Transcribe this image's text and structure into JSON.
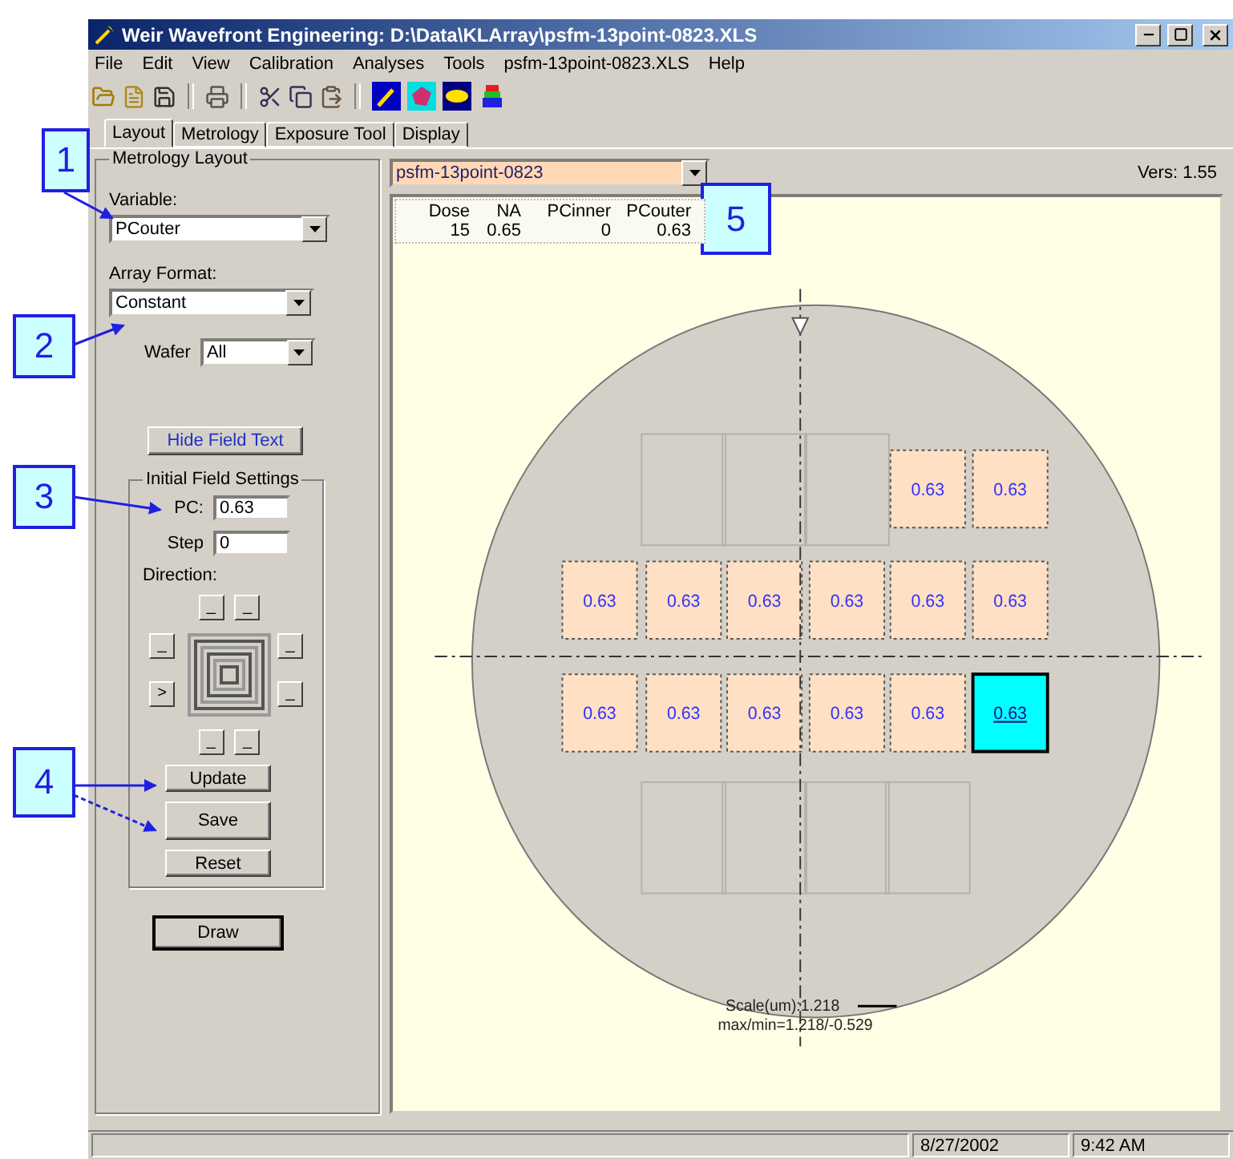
{
  "window": {
    "title": "Weir Wavefront Engineering: D:\\Data\\KLArray\\psfm-13point-0823.XLS"
  },
  "menu": [
    "File",
    "Edit",
    "View",
    "Calibration",
    "Analyses",
    "Tools",
    "psfm-13point-0823.XLS",
    "Help"
  ],
  "tabs": [
    {
      "label": "Layout",
      "selected": true
    },
    {
      "label": "Metrology",
      "selected": false
    },
    {
      "label": "Exposure Tool",
      "selected": false
    },
    {
      "label": "Display",
      "selected": false
    }
  ],
  "layout_panel": {
    "title": "Metrology Layout",
    "variable": {
      "label": "Variable:",
      "value": "PCouter"
    },
    "array_format": {
      "label": "Array Format:",
      "value": "Constant"
    },
    "wafer": {
      "label": "Wafer",
      "value": "All"
    },
    "hide_button": "Hide Field Text",
    "initial_settings": {
      "title": "Initial Field Settings",
      "pc": {
        "label": "PC:",
        "value": "0.63"
      },
      "step": {
        "label": "Step",
        "value": "0"
      },
      "direction_label": "Direction:",
      "direction_buttons": [
        "_",
        "_",
        "_",
        "_",
        ">",
        "_",
        "_",
        "_"
      ],
      "buttons": [
        "Update",
        "Save",
        "Reset"
      ]
    },
    "draw_button": {
      "label": "Draw",
      "default": true
    }
  },
  "layout_file": {
    "value": "psfm-13point-0823"
  },
  "version": "Vers: 1.55",
  "info_table": {
    "columns": [
      "Dose",
      "NA",
      "PCinner",
      "PCouter"
    ],
    "values": [
      "15",
      "0.65",
      "0",
      "0.63"
    ]
  },
  "wafer_map": {
    "rows": [
      {
        "cells": [
          {
            "kind": "none"
          },
          {
            "kind": "empty"
          },
          {
            "kind": "empty"
          },
          {
            "kind": "empty"
          },
          {
            "kind": "field",
            "value": "0.63",
            "selected": false
          },
          {
            "kind": "field",
            "value": "0.63",
            "selected": false
          }
        ]
      },
      {
        "cells": [
          {
            "kind": "field",
            "value": "0.63",
            "selected": false
          },
          {
            "kind": "field",
            "value": "0.63",
            "selected": false
          },
          {
            "kind": "field",
            "value": "0.63",
            "selected": false
          },
          {
            "kind": "field",
            "value": "0.63",
            "selected": false
          },
          {
            "kind": "field",
            "value": "0.63",
            "selected": false
          },
          {
            "kind": "field",
            "value": "0.63",
            "selected": false
          }
        ]
      },
      {
        "cells": [
          {
            "kind": "field",
            "value": "0.63",
            "selected": false
          },
          {
            "kind": "field",
            "value": "0.63",
            "selected": false
          },
          {
            "kind": "field",
            "value": "0.63",
            "selected": false
          },
          {
            "kind": "field",
            "value": "0.63",
            "selected": false
          },
          {
            "kind": "field",
            "value": "0.63",
            "selected": false
          },
          {
            "kind": "field",
            "value": "0.63",
            "selected": true
          }
        ]
      },
      {
        "cells": [
          {
            "kind": "none"
          },
          {
            "kind": "empty"
          },
          {
            "kind": "empty"
          },
          {
            "kind": "empty"
          },
          {
            "kind": "empty"
          },
          {
            "kind": "none"
          }
        ]
      }
    ],
    "scale": "Scale(um):1.218",
    "max_min": "max/min=1.218/-0.529"
  },
  "status_bar": {
    "date": "8/27/2002",
    "time": "9:42 AM"
  },
  "callouts": [
    {
      "number": "1"
    },
    {
      "number": "2"
    },
    {
      "number": "3"
    },
    {
      "number": "4"
    },
    {
      "number": "5"
    }
  ]
}
